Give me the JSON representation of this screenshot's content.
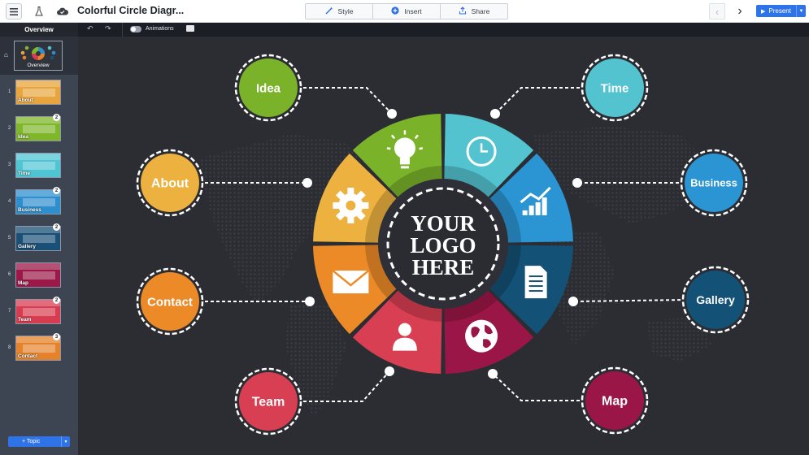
{
  "app": {
    "doc_title": "Colorful Circle Diagr...",
    "toolbar": {
      "style_label": "Style",
      "insert_label": "Insert",
      "share_label": "Share",
      "present_label": "Present"
    },
    "subbar": {
      "overview_label": "Overview",
      "animations_label": "Animations"
    }
  },
  "sidebar": {
    "overview_thumb_label": "Overview",
    "slides": [
      {
        "num": "1",
        "label": "About",
        "badge": "",
        "color": "#e9a53d"
      },
      {
        "num": "2",
        "label": "Idea",
        "badge": "2",
        "color": "#7fb62a"
      },
      {
        "num": "3",
        "label": "Time",
        "badge": "",
        "color": "#4fc4d3"
      },
      {
        "num": "4",
        "label": "Business",
        "badge": "2",
        "color": "#2e8fce"
      },
      {
        "num": "5",
        "label": "Gallery",
        "badge": "2",
        "color": "#1a4f76"
      },
      {
        "num": "6",
        "label": "Map",
        "badge": "",
        "color": "#9b1848"
      },
      {
        "num": "7",
        "label": "Team",
        "badge": "2",
        "color": "#d83c50"
      },
      {
        "num": "8",
        "label": "Contact",
        "badge": "3",
        "color": "#e5832c"
      }
    ],
    "add_topic_label": "+ Topic"
  },
  "diagram": {
    "center_text": [
      "YOUR",
      "LOGO",
      "HERE"
    ],
    "topics": [
      {
        "label": "Idea",
        "color": "#7ab32a"
      },
      {
        "label": "Time",
        "color": "#53c3d0"
      },
      {
        "label": "About",
        "color": "#ecb13f"
      },
      {
        "label": "Business",
        "color": "#2b94d2"
      },
      {
        "label": "Contact",
        "color": "#ec8a28"
      },
      {
        "label": "Gallery",
        "color": "#145176"
      },
      {
        "label": "Team",
        "color": "#d83f52"
      },
      {
        "label": "Map",
        "color": "#9a1646"
      }
    ]
  }
}
